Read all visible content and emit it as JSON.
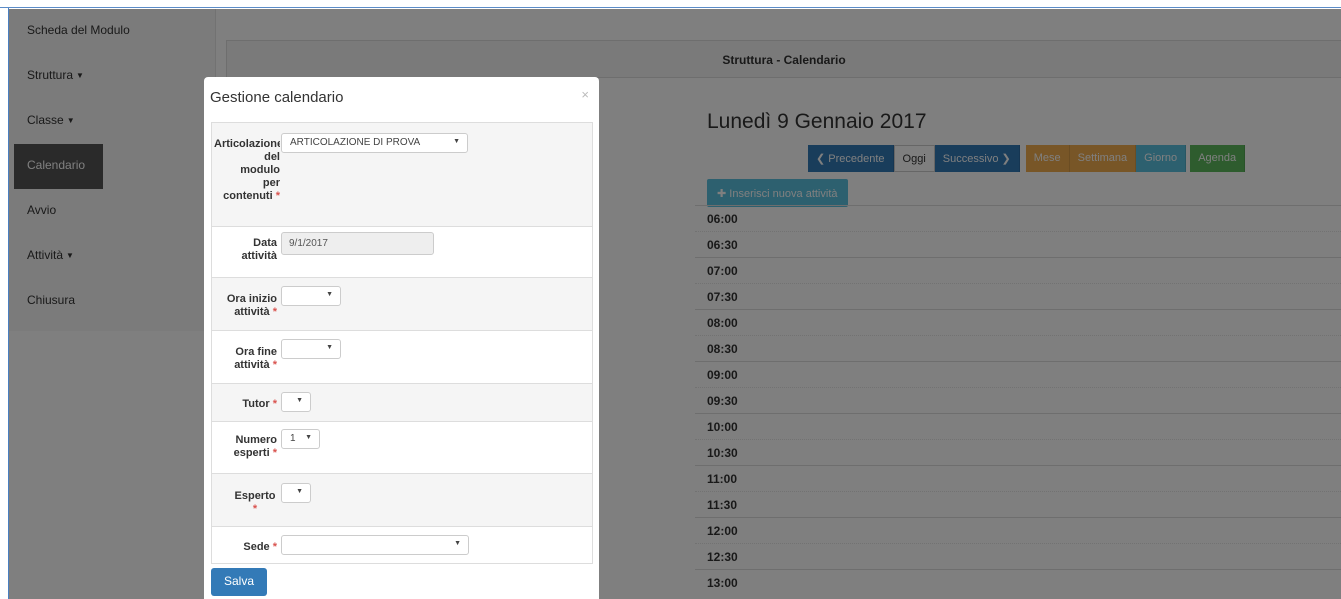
{
  "sidebar": {
    "items": [
      {
        "label": "Scheda del Modulo",
        "has_caret": false,
        "active": false
      },
      {
        "label": "Struttura",
        "has_caret": true,
        "active": false
      },
      {
        "label": "Classe",
        "has_caret": true,
        "active": false
      },
      {
        "label": "Calendario",
        "has_caret": false,
        "active": true
      },
      {
        "label": "Avvio",
        "has_caret": false,
        "active": false
      },
      {
        "label": "Attività",
        "has_caret": true,
        "active": false
      },
      {
        "label": "Chiusura",
        "has_caret": false,
        "active": false
      }
    ]
  },
  "panel": {
    "title": "Struttura - Calendario"
  },
  "calendar": {
    "date_title": "Lunedì 9 Gennaio 2017",
    "buttons": {
      "prev": "Precedente",
      "today": "Oggi",
      "next": "Successivo",
      "month": "Mese",
      "week": "Settimana",
      "day": "Giorno",
      "agenda": "Agenda"
    },
    "insert_label": "Inserisci nuova attività",
    "slots": [
      "06:00",
      "06:30",
      "07:00",
      "07:30",
      "08:00",
      "08:30",
      "09:00",
      "09:30",
      "10:00",
      "10:30",
      "11:00",
      "11:30",
      "12:00",
      "12:30",
      "13:00"
    ]
  },
  "modal": {
    "title": "Gestione calendario",
    "close": "×",
    "fields": {
      "articolazione": {
        "label_lines": [
          "Articolazione",
          "del",
          "modulo",
          "per",
          "contenuti"
        ],
        "value": "ARTICOLAZIONE DI PROVA"
      },
      "data": {
        "label_lines": [
          "Data",
          "attività"
        ],
        "value": "9/1/2017"
      },
      "ora_inizio": {
        "label_lines": [
          "Ora inizio",
          "attività"
        ],
        "value": ""
      },
      "ora_fine": {
        "label_lines": [
          "Ora fine",
          "attività"
        ],
        "value": ""
      },
      "tutor": {
        "label": "Tutor",
        "value": ""
      },
      "numero_esperti": {
        "label_lines": [
          "Numero",
          "esperti"
        ],
        "value": "1"
      },
      "esperto": {
        "label": "Esperto",
        "value": ""
      },
      "sede": {
        "label": "Sede",
        "value": ""
      }
    },
    "required_mark": "*",
    "save_label": "Salva"
  },
  "colors": {
    "primary": "#337ab7",
    "info": "#5bc0de",
    "warning": "#f0ad4e",
    "success": "#5cb85c",
    "required": "#d9534f",
    "sidebar_active": "#555555"
  },
  "icons": {
    "prev": "chevron-left-icon",
    "next": "chevron-right-icon",
    "insert": "plus-icon",
    "caret": "caret-down-icon",
    "close": "close-icon"
  }
}
